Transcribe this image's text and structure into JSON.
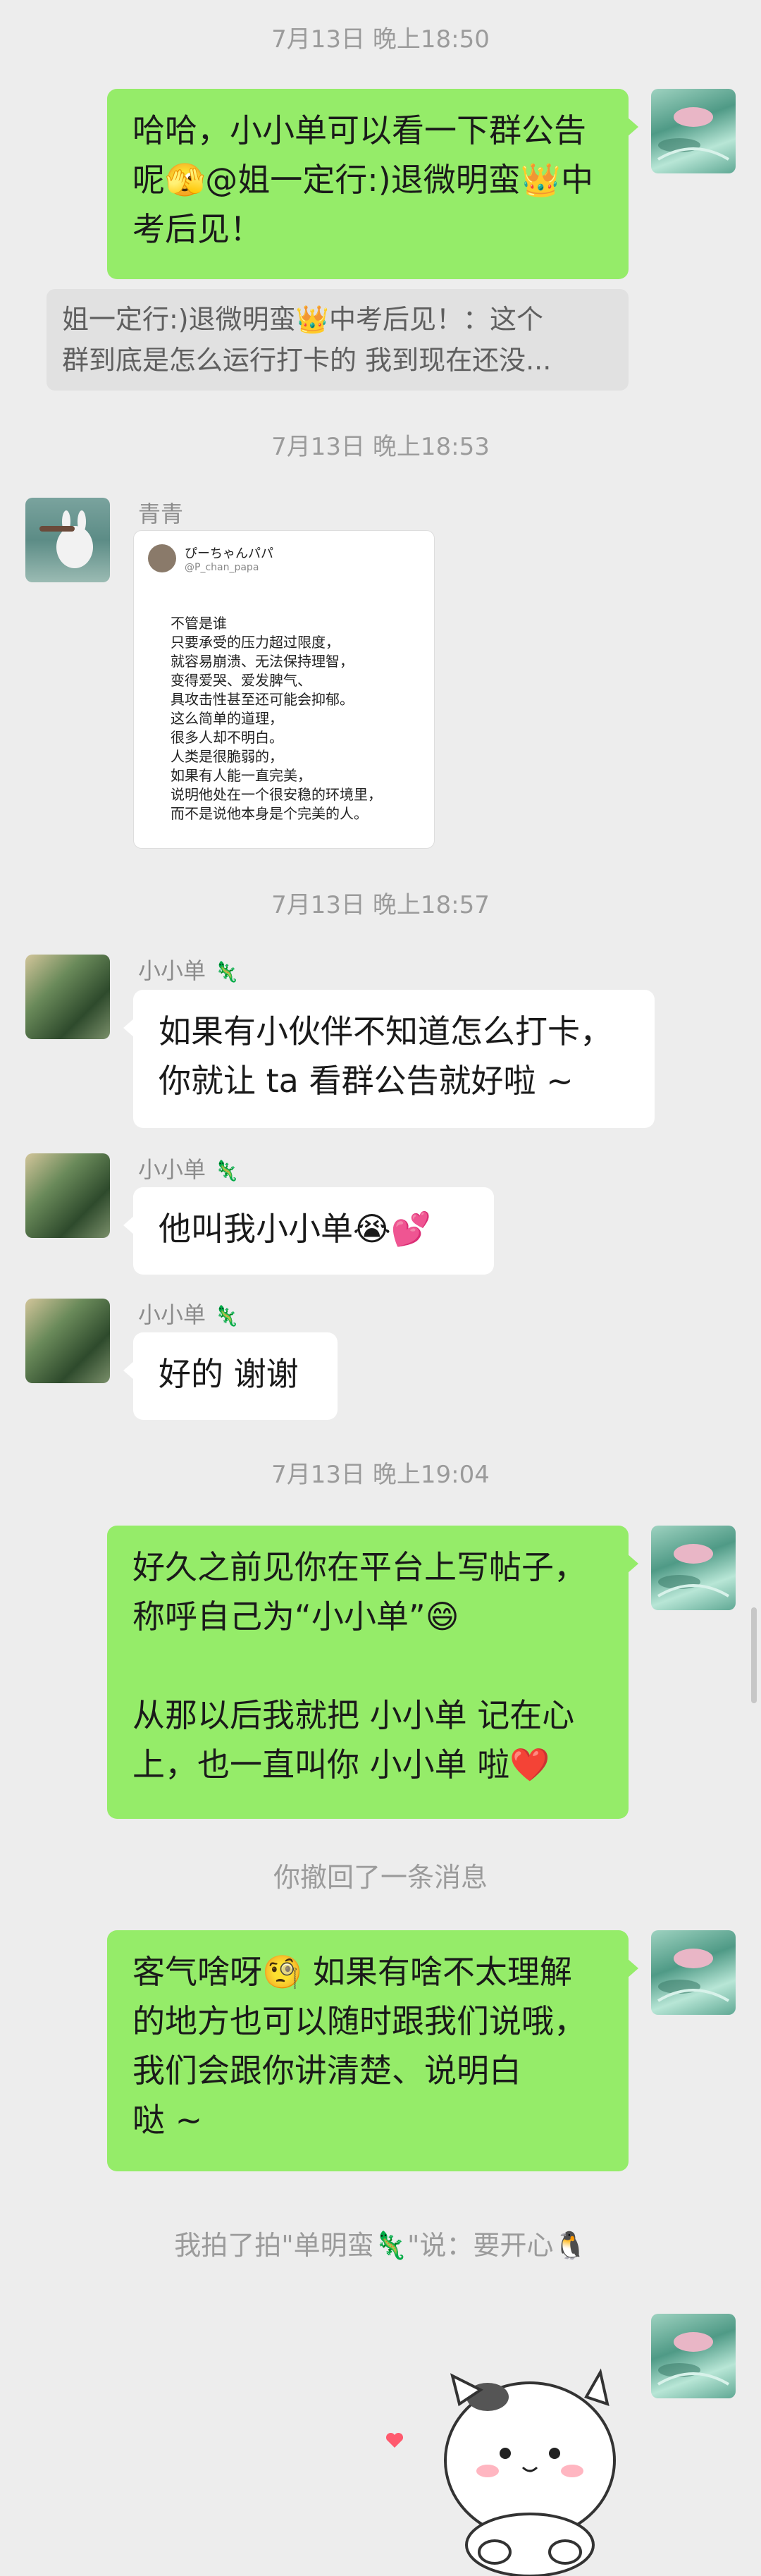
{
  "messages": {
    "ts1": "7月13日 晚上18:50",
    "msg1": "哈哈，小小单可以看一下群公告呢🫣@姐一定行:)退微明蛮👑中考后见！",
    "quote": {
      "line1": "姐一定行:)退微明蛮👑中考后见！：这个",
      "line2": "群到底是怎么运行打卡的 我到现在还没..."
    },
    "ts2": "7月13日 晚上18:53",
    "sender_qingqing": "青青",
    "image_post": {
      "username": "ぴーちゃんパパ",
      "handle": "@P_chan_papa",
      "lines": [
        "不管是谁",
        "只要承受的压力超过限度，",
        "就容易崩溃、无法保持理智，",
        "变得爱哭、爱发脾气、",
        "具攻击性甚至还可能会抑郁。",
        "这么简单的道理，",
        "很多人却不明白。",
        "人类是很脆弱的，",
        "如果有人能一直完美，",
        "说明他处在一个很安稳的环境里，",
        "而不是说他本身是个完美的人。"
      ]
    },
    "ts3": "7月13日 晚上18:57",
    "sender_xxd": "小小单",
    "sender_badge": "🦎",
    "msg2": "如果有小伙伴不知道怎么打卡，\n你就让 ta 看群公告就好啦 ~",
    "msg3": "他叫我小小单😭💕",
    "msg4": "好的 谢谢",
    "ts4": "7月13日 晚上19:04",
    "msg5": "好久之前见你在平台上写帖子，\n称呼自己为“小小单”😄\n\n从那以后我就把 小小单 记在心\n上，也一直叫你 小小单 啦❤️",
    "recall": "你撤回了一条消息",
    "msg6": "客气啥呀🧐 如果有啥不太理解\n的地方也可以随时跟我们说哦，\n我们会跟你讲清楚、说明白\n哒 ~",
    "pat": "我拍了拍\"单明蛮🦎\"说：要开心🐧"
  },
  "colors": {
    "background": "#ededed",
    "self_bubble": "#95ec69",
    "other_bubble": "#ffffff"
  }
}
